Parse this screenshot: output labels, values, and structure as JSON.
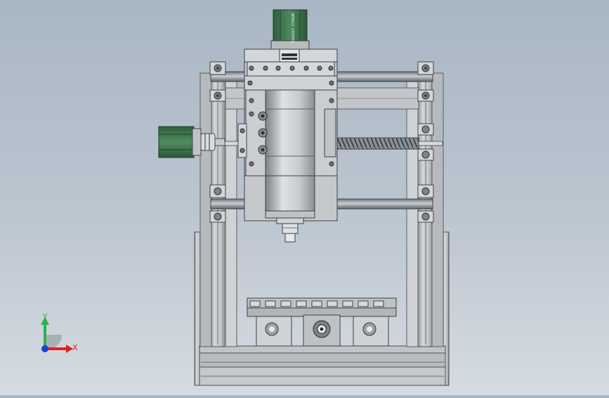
{
  "model": {
    "motor_label": "NEMA23 STEPPER"
  },
  "triad": {
    "x_label": "X",
    "y_label": "Y",
    "x_color": "#e0201c",
    "y_color": "#2bb24c",
    "z_color": "#1f3fd6"
  },
  "colors": {
    "background_top": "#a9b6c4",
    "background_bottom": "#d6dbe1",
    "frame": "#c9ccce",
    "motor_green": "#3b7a4c",
    "rail": "#9aa1a7"
  }
}
